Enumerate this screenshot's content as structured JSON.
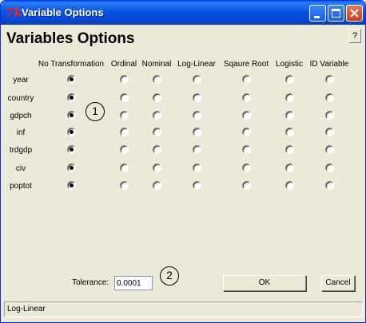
{
  "window": {
    "title": "Variable Options",
    "app_icon": "tk-feather-icon"
  },
  "titlebar_buttons": {
    "minimize": "minimize-icon",
    "maximize": "maximize-icon",
    "close": "close-icon"
  },
  "help_label": "?",
  "heading": "Variables Options",
  "columns": [
    "No Transformation",
    "Ordinal",
    "Nominal",
    "Log-Linear",
    "Sqaure Root",
    "Logistic",
    "ID Variable"
  ],
  "rows": [
    {
      "label": "year",
      "selected": 0
    },
    {
      "label": "country",
      "selected": 0
    },
    {
      "label": "gdpch",
      "selected": 0
    },
    {
      "label": "inf",
      "selected": 0
    },
    {
      "label": "trdgdp",
      "selected": 0
    },
    {
      "label": "civ",
      "selected": 0
    },
    {
      "label": "poptot",
      "selected": 0
    }
  ],
  "callouts": [
    "1",
    "2"
  ],
  "tolerance": {
    "label": "Tolerance:",
    "value": "0.0001"
  },
  "buttons": {
    "ok": "OK",
    "cancel": "Cancel"
  },
  "status": "Log-Linear"
}
